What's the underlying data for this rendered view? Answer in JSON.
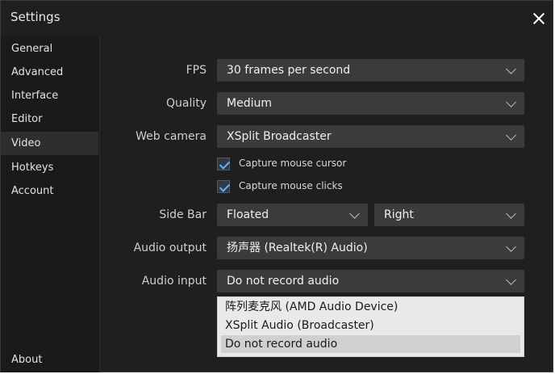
{
  "window": {
    "title": "Settings"
  },
  "sidebar": {
    "items": [
      {
        "label": "General"
      },
      {
        "label": "Advanced"
      },
      {
        "label": "Interface"
      },
      {
        "label": "Editor"
      },
      {
        "label": "Video"
      },
      {
        "label": "Hotkeys"
      },
      {
        "label": "Account"
      }
    ],
    "active": "Video",
    "about": "About"
  },
  "form": {
    "fps": {
      "label": "FPS",
      "value": "30 frames per second"
    },
    "quality": {
      "label": "Quality",
      "value": "Medium"
    },
    "webcam": {
      "label": "Web camera",
      "value": "XSplit Broadcaster"
    },
    "capture_cursor": {
      "label": "Capture mouse cursor",
      "checked": true
    },
    "capture_clicks": {
      "label": "Capture mouse clicks",
      "checked": true
    },
    "sidebar": {
      "label": "Side Bar",
      "mode": "Floated",
      "position": "Right"
    },
    "audio_output": {
      "label": "Audio output",
      "value": "扬声器 (Realtek(R) Audio)"
    },
    "audio_input": {
      "label": "Audio input",
      "value": "Do not record audio",
      "options": [
        "阵列麦克风 (AMD Audio Device)",
        "XSplit Audio (Broadcaster)",
        "Do not record audio"
      ]
    }
  },
  "colors": {
    "window_bg": "#1f1f1f",
    "select_bg": "#3b3b3b",
    "check_accent": "#5fb0ff"
  },
  "icons": {
    "close": "close-icon",
    "chevron": "chevron-down-icon",
    "check": "check-icon"
  }
}
